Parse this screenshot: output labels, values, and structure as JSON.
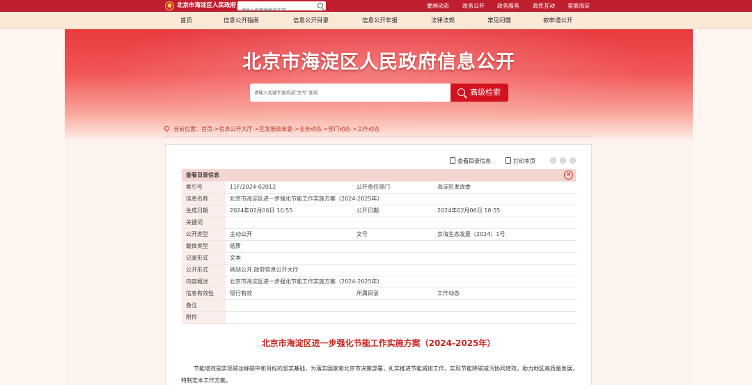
{
  "topbar": {
    "site_name": "北京市海淀区人民政府",
    "search_placeholder": "请输入您要搜索的内容",
    "links": [
      "要闻动态",
      "政务公开",
      "政务服务",
      "政民互动",
      "美丽海淀"
    ]
  },
  "nav": {
    "items": [
      "首页",
      "信息公开指南",
      "信息公开目录",
      "信息公开年报",
      "法律法规",
      "常见问题",
      "依申请公开"
    ]
  },
  "banner": {
    "title": "北京市海淀区人民政府信息公开",
    "search_placeholder": "请输入关键字查询或“文号”查询",
    "advanced_search_label": "高级检索"
  },
  "breadcrumb": {
    "text": "当前位置：首页->信息公开大厅->区发展改革委->业务动态->部门动态->工作动态"
  },
  "tools": {
    "view_catalog_label": "查看目录信息",
    "print_label": "打印本页"
  },
  "info_table": {
    "header": "查看目录信息",
    "rows": [
      {
        "label": "索引号",
        "value": "11F/2024-02012",
        "label2": "公开责任部门",
        "value2": "海淀区发改委"
      },
      {
        "label": "信息名称",
        "value": "北京市海淀区进一步强化节能工作实施方案（2024-2025年）"
      },
      {
        "label": "生成日期",
        "value": "2024年02月06日 10:55",
        "label2": "公开日期",
        "value2": "2024年02月06日 10:55"
      },
      {
        "label": "关键词",
        "value": ""
      },
      {
        "label": "公开类型",
        "value": "主动公开",
        "label2": "文号",
        "value2": "京海生态发展〔2024〕1号"
      },
      {
        "label": "载体类型",
        "value": "纸质"
      },
      {
        "label": "记录形式",
        "value": "文本"
      },
      {
        "label": "公开形式",
        "value": "网站公开,政府信息公开大厅"
      },
      {
        "label": "内容概述",
        "value": "北京市海淀区进一步强化节能工作实施方案（2024-2025年）"
      },
      {
        "label": "信息有效性",
        "value": "现行有效",
        "label2": "所属目录",
        "value2": "工作动态"
      },
      {
        "label": "备注",
        "value": ""
      },
      {
        "label": "附件",
        "value": ""
      }
    ]
  },
  "article": {
    "title": "北京市海淀区进一步强化节能工作实施方案（2024-2025年）",
    "body": "节能增效是实现碳达峰碳中和目标的坚实基础，为落实国家和北京市决策部署，扎实推进节能减排工作，实现节能降碳减污协同增效，助力地区高质量发展，特制定本工作方案。"
  },
  "colors": {
    "topbar": "#bf1e2e",
    "accent": "#d3121f",
    "nav_bg": "#fbe8d6"
  }
}
